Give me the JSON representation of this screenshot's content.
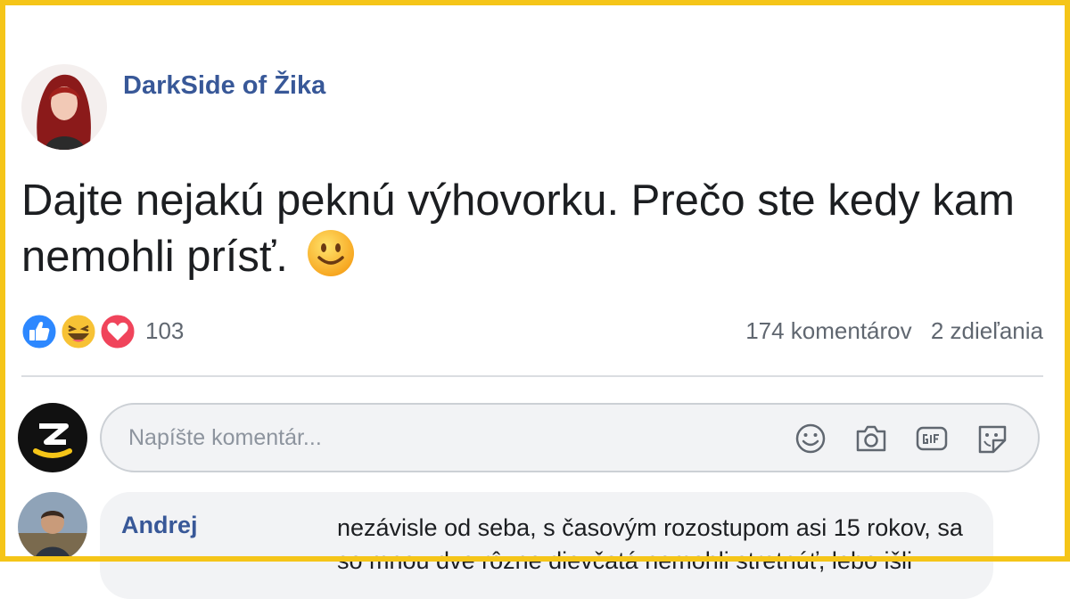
{
  "post": {
    "author": "DarkSide of Žika",
    "text": "Dajte nejakú peknú výhovorku. Prečo ste kedy kam nemohli prísť.",
    "emoji": "slightly-smiling-face"
  },
  "reactions": {
    "icons": [
      "like-icon",
      "haha-icon",
      "love-icon"
    ],
    "count": "103"
  },
  "stats": {
    "comments": "174 komentárov",
    "shares": "2 zdieľania"
  },
  "composer": {
    "placeholder": "Napíšte komentár...",
    "icons": [
      "emoji-icon",
      "camera-icon",
      "gif-icon",
      "sticker-icon"
    ]
  },
  "reply": {
    "author": "Andrej",
    "text": "nezávisle od seba, s časovým rozostupom asi 15 rokov, sa so mnou dve rôzne dievčatá nemohli stretnúť, lebo išli"
  },
  "colors": {
    "border": "#f5c518",
    "link": "#385898",
    "text": "#1c1e21",
    "meta": "#606770",
    "bubble": "#f2f3f5"
  }
}
